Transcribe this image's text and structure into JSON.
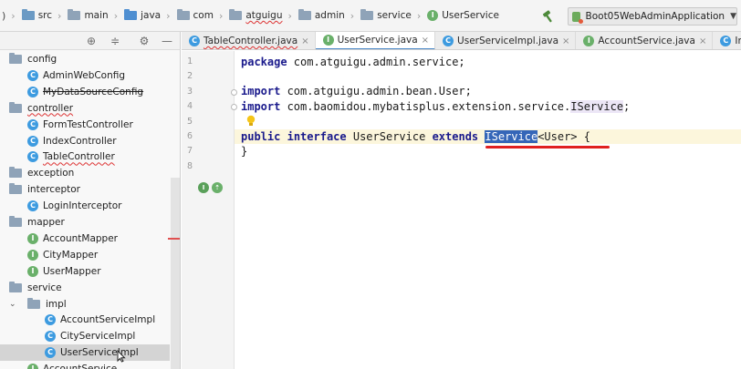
{
  "breadcrumb": {
    "leading": ")",
    "items": [
      "src",
      "main",
      "java",
      "com",
      "atguigu",
      "admin",
      "service"
    ],
    "file": "UserService",
    "file_badge": "I"
  },
  "run_config": {
    "label": "Boot05WebAdminApplication",
    "caret": "▼"
  },
  "project_toolbar": {
    "icons": [
      "crosshair-icon",
      "collapse-all-icon",
      "gear-icon",
      "hide-icon"
    ]
  },
  "tree": [
    {
      "label": "config",
      "kind": "folder",
      "badge": ""
    },
    {
      "label": "AdminWebConfig",
      "kind": "class",
      "badge": "C"
    },
    {
      "label": "MyDataSourceConfig",
      "kind": "class",
      "badge": "C",
      "strike": true
    },
    {
      "label": "controller",
      "kind": "folder",
      "badge": "",
      "wavy": true
    },
    {
      "label": "FormTestController",
      "kind": "class",
      "badge": "C"
    },
    {
      "label": "IndexController",
      "kind": "class",
      "badge": "C"
    },
    {
      "label": "TableController",
      "kind": "class",
      "badge": "C",
      "wavy": true
    },
    {
      "label": "exception",
      "kind": "folder",
      "badge": ""
    },
    {
      "label": "interceptor",
      "kind": "folder",
      "badge": ""
    },
    {
      "label": "LoginInterceptor",
      "kind": "class",
      "badge": "C"
    },
    {
      "label": "mapper",
      "kind": "folder",
      "badge": ""
    },
    {
      "label": "AccountMapper",
      "kind": "interface",
      "badge": "I"
    },
    {
      "label": "CityMapper",
      "kind": "interface",
      "badge": "I"
    },
    {
      "label": "UserMapper",
      "kind": "interface",
      "badge": "I"
    },
    {
      "label": "service",
      "kind": "folder",
      "badge": ""
    },
    {
      "label": "impl",
      "kind": "folder-open",
      "badge": "",
      "twisty": "⌄"
    },
    {
      "label": "AccountServiceImpl",
      "kind": "class",
      "badge": "C"
    },
    {
      "label": "CityServiceImpl",
      "kind": "class",
      "badge": "C"
    },
    {
      "label": "UserServiceImpl",
      "kind": "class",
      "badge": "C",
      "selected": true
    },
    {
      "label": "AccountService",
      "kind": "interface",
      "badge": "I"
    }
  ],
  "tabs": [
    {
      "label": "TableController.java",
      "badge": "C",
      "kind": "class",
      "close": "×",
      "wavy": true
    },
    {
      "label": "UserService.java",
      "badge": "I",
      "kind": "interface",
      "close": "×",
      "active": true
    },
    {
      "label": "UserServiceImpl.java",
      "badge": "C",
      "kind": "class",
      "close": "×"
    },
    {
      "label": "AccountService.java",
      "badge": "I",
      "kind": "interface",
      "close": "×"
    },
    {
      "label": "IndexController",
      "badge": "C",
      "kind": "class",
      "close": ""
    }
  ],
  "editor": {
    "line_numbers": [
      "1",
      "2",
      "3",
      "4",
      "5",
      "6",
      "7",
      "8"
    ],
    "lines": {
      "l1_kw": "package",
      "l1_rest": " com.atguigu.admin.service;",
      "l3_kw": "import",
      "l3_rest": " com.atguigu.admin.bean.User;",
      "l4_kw": "import",
      "l4_rest": " com.baomidou.mybatisplus.extension.service.",
      "l4_tail": "IService",
      "l4_end": ";",
      "l6_kw1": "public",
      "l6_kw2": "interface",
      "l6_name": "UserService",
      "l6_kw3": "extends",
      "l6_sel": "IService",
      "l6_rest": "<User> {",
      "l7": "}"
    },
    "colors": {
      "keyword": "#1a1a8c",
      "selection": "#3566b8",
      "current_line": "#fcf6dc",
      "annotation_underline": "#e02020"
    }
  }
}
